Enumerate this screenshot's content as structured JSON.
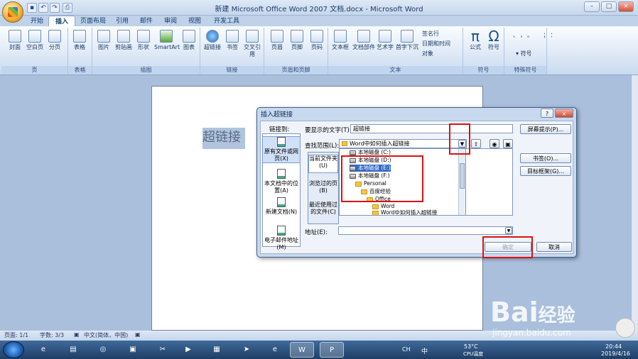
{
  "window": {
    "title": "新建 Microsoft Office Word 2007 文档.docx - Microsoft Word",
    "controls": [
      "–",
      "□",
      "×"
    ]
  },
  "ribbon": {
    "tabs": [
      "开始",
      "插入",
      "页面布局",
      "引用",
      "邮件",
      "审阅",
      "视图",
      "开发工具"
    ],
    "active_tab": "插入",
    "groups": [
      {
        "label": "页",
        "buttons": [
          "封面",
          "空白页",
          "分页"
        ]
      },
      {
        "label": "表格",
        "buttons": [
          "表格"
        ]
      },
      {
        "label": "插图",
        "buttons": [
          "图片",
          "剪贴画",
          "形状",
          "SmartArt",
          "图表"
        ]
      },
      {
        "label": "链接",
        "buttons": [
          "超链接",
          "书签",
          "交叉引用"
        ]
      },
      {
        "label": "页眉和页脚",
        "buttons": [
          "页眉",
          "页脚",
          "页码"
        ]
      },
      {
        "label": "文本",
        "buttons": [
          "文本框",
          "文档部件",
          "艺术字",
          "首字下沉"
        ],
        "small": [
          "签名行",
          "日期和时间",
          "对象"
        ]
      },
      {
        "label": "符号",
        "buttons": [
          "公式",
          "符号"
        ]
      },
      {
        "label": "特殊符号",
        "buttons": [
          "符号"
        ]
      }
    ]
  },
  "document": {
    "selected_text": "超链接"
  },
  "dialog": {
    "title": "插入超链接",
    "link_to_label": "链接到:",
    "link_to_items": [
      "原有文件或网页(X)",
      "本文档中的位置(A)",
      "新建文档(N)",
      "电子邮件地址(M)"
    ],
    "display_text_label": "要显示的文字(T):",
    "display_text_value": "超链接",
    "screen_tip_button": "屏幕提示(P)...",
    "look_in_label": "查找范围(L):",
    "look_in_value": "Word中如何插入超链接",
    "subtabs": [
      "当前文件夹(U)",
      "浏览过的页(B)",
      "最近使用过的文件(C)"
    ],
    "file_list": [
      {
        "name": "本地磁盘 (C:)",
        "type": "drive"
      },
      {
        "name": "本地磁盘 (D:)",
        "type": "drive"
      },
      {
        "name": "本地磁盘 (E:)",
        "type": "drive",
        "selected": true
      },
      {
        "name": "本地磁盘 (F:)",
        "type": "drive"
      },
      {
        "name": "Personal",
        "type": "folder"
      },
      {
        "name": "百度经验",
        "type": "folder"
      },
      {
        "name": "Office",
        "type": "folder"
      },
      {
        "name": "Word",
        "type": "folder"
      },
      {
        "name": "Word中如何插入超链接",
        "type": "folder"
      }
    ],
    "bookmark_button": "书签(O)...",
    "target_frame_button": "目标框架(G)...",
    "address_label": "地址(E):",
    "address_value": "",
    "ok_button": "确定",
    "cancel_button": "取消",
    "help_button": "?",
    "close_button": "×"
  },
  "statusbar": {
    "page": "页面: 1/1",
    "words": "字数: 3/3",
    "language": "中文(简体，中国)"
  },
  "tray": {
    "temp": "53°C",
    "temp_label": "CPU温度",
    "time": "20:44",
    "date": "2019/4/16",
    "ime": "中"
  },
  "watermark": {
    "brand": "Bai",
    "brand_cn": "经验",
    "url": "jingyan.baidu.com"
  }
}
